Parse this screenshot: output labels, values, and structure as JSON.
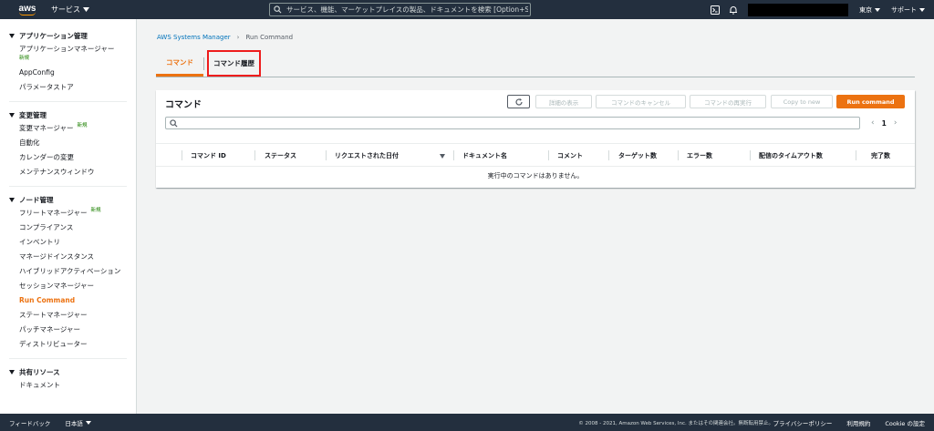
{
  "topnav": {
    "logo": "aws",
    "services_label": "サービス",
    "search_placeholder": "サービス、機能、マーケットプレイスの製品、ドキュメントを検索 [Option+S]",
    "region_label": "東京",
    "support_label": "サポート"
  },
  "sidebar": {
    "sections": [
      {
        "title": "アプリケーション管理",
        "items": [
          {
            "label": "アプリケーションマネージャー",
            "badge": "新規"
          },
          {
            "label": "AppConfig"
          },
          {
            "label": "パラメータストア"
          }
        ]
      },
      {
        "title": "変更管理",
        "items": [
          {
            "label": "変更マネージャー",
            "badge": "新規"
          },
          {
            "label": "自動化"
          },
          {
            "label": "カレンダーの変更"
          },
          {
            "label": "メンテナンスウィンドウ"
          }
        ]
      },
      {
        "title": "ノード管理",
        "items": [
          {
            "label": "フリートマネージャー",
            "badge": "新規"
          },
          {
            "label": "コンプライアンス"
          },
          {
            "label": "インベントリ"
          },
          {
            "label": "マネージドインスタンス"
          },
          {
            "label": "ハイブリッドアクティベーション"
          },
          {
            "label": "セッションマネージャー"
          },
          {
            "label": "Run Command"
          },
          {
            "label": "ステートマネージャー"
          },
          {
            "label": "パッチマネージャー"
          },
          {
            "label": "ディストリビューター"
          }
        ]
      },
      {
        "title": "共有リソース",
        "items": [
          {
            "label": "ドキュメント"
          }
        ]
      }
    ]
  },
  "breadcrumb": {
    "root": "AWS Systems Manager",
    "current": "Run Command"
  },
  "tabs": [
    {
      "label": "コマンド"
    },
    {
      "label": "コマンド履歴"
    }
  ],
  "panel": {
    "title": "コマンド",
    "buttons": {
      "details": "詳細の表示",
      "cancel": "コマンドのキャンセル",
      "rerun": "コマンドの再実行",
      "copy": "Copy to new",
      "run": "Run command"
    },
    "filter_placeholder": "",
    "page": "1",
    "columns": [
      "コマンド ID",
      "ステータス",
      "リクエストされた日付",
      "ドキュメント名",
      "コメント",
      "ターゲット数",
      "エラー数",
      "配信のタイムアウト数",
      "完了数"
    ],
    "empty_message": "実行中のコマンドはありません。"
  },
  "footer": {
    "feedback": "フィードバック",
    "language": "日本語",
    "copyright": "© 2008 - 2021, Amazon Web Services, Inc. またはその関連会社。無断転用禁止。",
    "privacy": "プライバシーポリシー",
    "terms": "利用規約",
    "cookie": "Cookie の設定"
  }
}
